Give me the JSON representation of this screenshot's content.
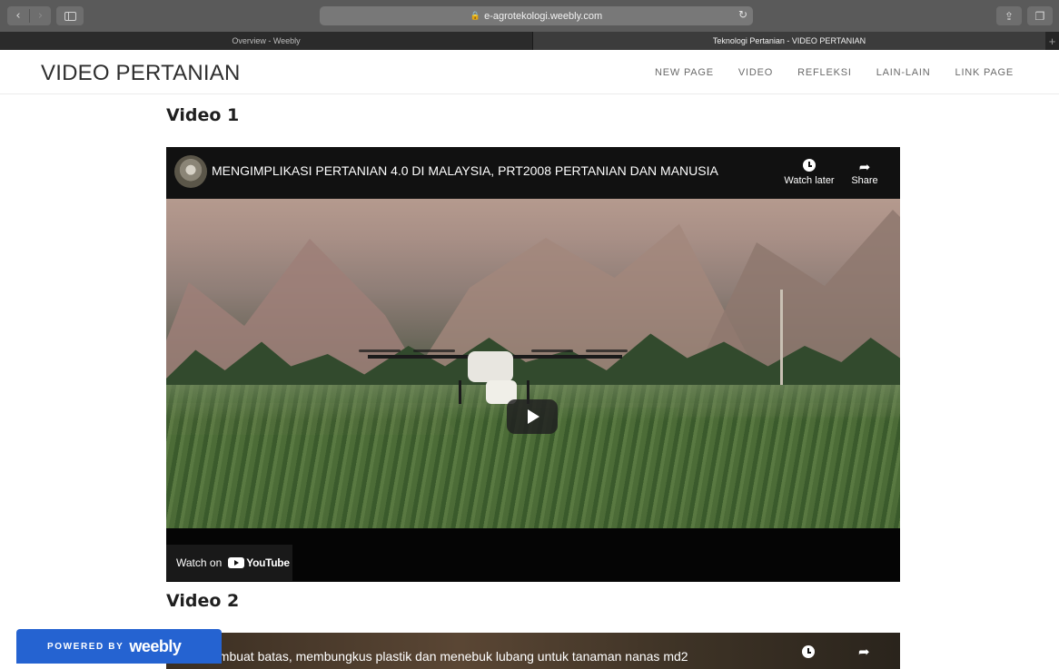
{
  "browser": {
    "url": "e-agrotekologi.weebly.com",
    "tabs": [
      {
        "label": "Overview - Weebly",
        "active": false
      },
      {
        "label": "Teknologi Pertanian - VIDEO PERTANIAN",
        "active": true
      }
    ],
    "new_tab_label": "+"
  },
  "site": {
    "title": "VIDEO PERTANIAN",
    "nav": [
      {
        "label": "NEW PAGE"
      },
      {
        "label": "VIDEO"
      },
      {
        "label": "REFLEKSI"
      },
      {
        "label": "LAIN-LAIN"
      },
      {
        "label": "LINK PAGE"
      }
    ]
  },
  "videos": [
    {
      "heading": "Video 1",
      "title": "MENGIMPLIKASI PERTANIAN 4.0 DI MALAYSIA, PRT2008 PERTANIAN DAN MANUSIA",
      "watch_later": "Watch later",
      "share": "Share",
      "watch_on": "Watch on",
      "youtube": "YouTube"
    },
    {
      "heading": "Video 2",
      "title": "embuat batas, membungkus plastik dan menebuk lubang untuk tanaman nanas md2"
    }
  ],
  "weebly_badge": {
    "powered_by": "POWERED BY",
    "brand": "weebly"
  },
  "colors": {
    "badge_blue": "#2563d1",
    "toolbar": "#5a5a5a"
  }
}
